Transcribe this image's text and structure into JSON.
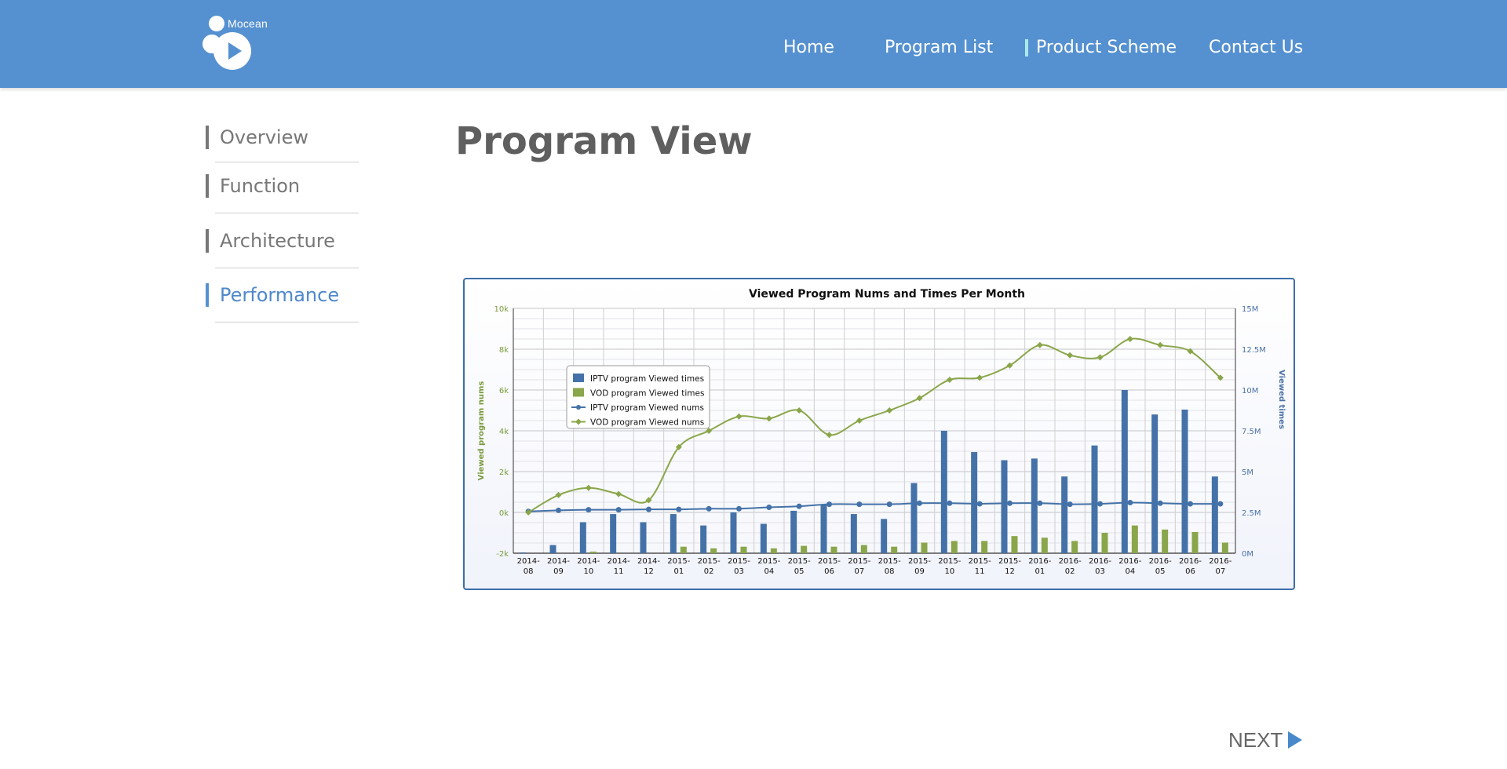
{
  "header": {
    "logo_text": "Mocean",
    "nav": [
      {
        "label": "Home"
      },
      {
        "label": "Program List"
      },
      {
        "label": "Product Scheme"
      },
      {
        "label": "Contact Us"
      }
    ]
  },
  "sidebar": {
    "items": [
      {
        "label": "Overview"
      },
      {
        "label": "Function"
      },
      {
        "label": "Architecture"
      },
      {
        "label": "Performance"
      }
    ],
    "active": "Performance"
  },
  "page_title": "Program View",
  "next_label": "NEXT",
  "colors": {
    "header_bg": "#5591d0",
    "iptv": "#4472a8",
    "vod": "#8aa64a",
    "active_sidebar": "#4f88cb"
  },
  "chart_data": {
    "type": "bar+line",
    "title": "Viewed Program Nums and Times Per Month",
    "ylabel_left": "Viewed program nums",
    "ylabel_right": "Viewed times",
    "left_axis": {
      "min": -2000,
      "max": 10000,
      "ticks": [
        "-2k",
        "0k",
        "2k",
        "4k",
        "6k",
        "8k",
        "10k"
      ]
    },
    "right_axis": {
      "min": 0,
      "max": 15000000,
      "ticks": [
        "0M",
        "2.5M",
        "5M",
        "7.5M",
        "10M",
        "12.5M",
        "15M"
      ]
    },
    "categories": [
      "2014-08",
      "2014-09",
      "2014-10",
      "2014-11",
      "2014-12",
      "2015-01",
      "2015-02",
      "2015-03",
      "2015-04",
      "2015-05",
      "2015-06",
      "2015-07",
      "2015-08",
      "2015-09",
      "2015-10",
      "2015-11",
      "2015-12",
      "2016-01",
      "2016-02",
      "2016-03",
      "2016-04",
      "2016-05",
      "2016-06",
      "2016-07"
    ],
    "legend_position": "upper-left inside plot",
    "grid": true,
    "series": [
      {
        "name": "IPTV program Viewed times",
        "kind": "bar",
        "axis": "right",
        "values": [
          50000,
          500000,
          1900000,
          2400000,
          1900000,
          2400000,
          1700000,
          2500000,
          1800000,
          2600000,
          3000000,
          2400000,
          2100000,
          4300000,
          7500000,
          6200000,
          5700000,
          5800000,
          4700000,
          6600000,
          10000000,
          8500000,
          8800000,
          4700000
        ]
      },
      {
        "name": "VOD program Viewed times",
        "kind": "bar",
        "axis": "right",
        "values": [
          0,
          0,
          100000,
          0,
          0,
          400000,
          300000,
          400000,
          300000,
          450000,
          400000,
          500000,
          400000,
          650000,
          750000,
          750000,
          1050000,
          950000,
          750000,
          1250000,
          1700000,
          1450000,
          1300000,
          650000
        ]
      },
      {
        "name": "IPTV program Viewed nums",
        "kind": "line",
        "axis": "left",
        "values": [
          50,
          100,
          130,
          130,
          150,
          150,
          180,
          180,
          250,
          300,
          400,
          400,
          400,
          450,
          450,
          420,
          450,
          450,
          400,
          420,
          480,
          450,
          420,
          420
        ]
      },
      {
        "name": "VOD program Viewed nums",
        "kind": "line",
        "axis": "left",
        "values": [
          0,
          850,
          1200,
          900,
          600,
          3200,
          4000,
          4700,
          4600,
          5000,
          3800,
          4500,
          5000,
          5600,
          6500,
          6600,
          7200,
          8200,
          7700,
          7600,
          8500,
          8200,
          7900,
          6600
        ]
      }
    ]
  }
}
